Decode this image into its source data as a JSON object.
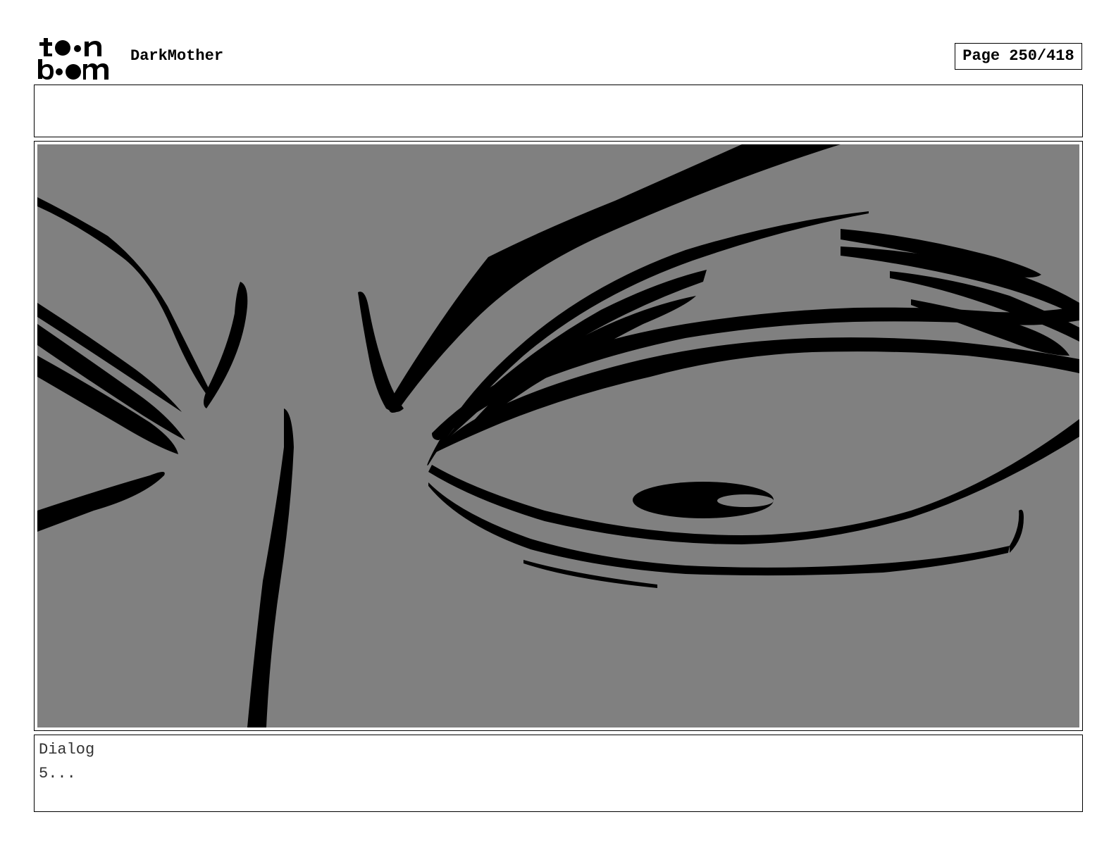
{
  "header": {
    "logo_name": "toon boom logo",
    "project_title": "DarkMother",
    "page_indicator": "Page 250/418"
  },
  "notes": {
    "text": ""
  },
  "panel": {
    "background_color": "#808080",
    "stroke_color": "#000000"
  },
  "dialog": {
    "label": "Dialog",
    "text": "5..."
  }
}
